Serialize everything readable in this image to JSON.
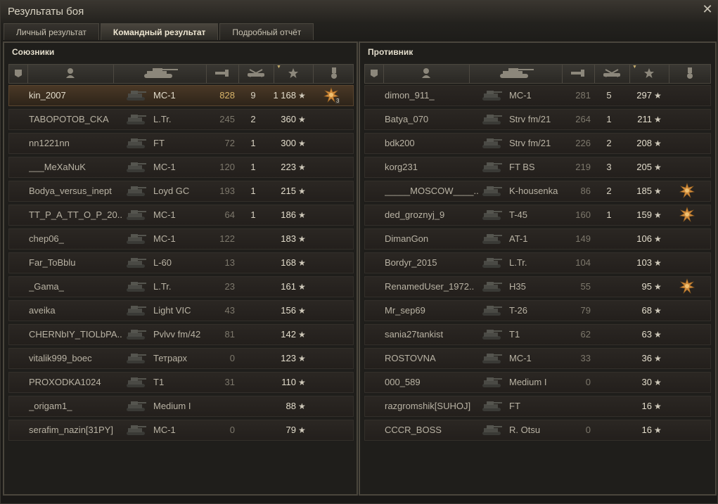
{
  "window": {
    "title": "Результаты боя"
  },
  "tabs": [
    {
      "label": "Личный результат",
      "active": false
    },
    {
      "label": "Командный результат",
      "active": true
    },
    {
      "label": "Подробный отчёт",
      "active": false
    }
  ],
  "header_icons": [
    "rank-icon",
    "player-icon",
    "tank-icon",
    "damage-icon",
    "kills-icon",
    "experience-star-icon",
    "medal-icon"
  ],
  "allies": {
    "title": "Союзники",
    "rows": [
      {
        "name": "kin_2007",
        "tank": "MC-1",
        "damage": "828",
        "kills": "9",
        "xp": "1 168",
        "medal": "3",
        "player": true
      },
      {
        "name": "TABOPOTOB_CKA",
        "tank": "L.Tr.",
        "damage": "245",
        "kills": "2",
        "xp": "360"
      },
      {
        "name": "nn1221nn",
        "tank": "FT",
        "damage": "72",
        "kills": "1",
        "xp": "300"
      },
      {
        "name": "___MeXaNuK",
        "tank": "MC-1",
        "damage": "120",
        "kills": "1",
        "xp": "223"
      },
      {
        "name": "Bodya_versus_inept",
        "tank": "Loyd GC",
        "damage": "193",
        "kills": "1",
        "xp": "215"
      },
      {
        "name": "TT_P_A_TT_O_P_20..",
        "tank": "MC-1",
        "damage": "64",
        "kills": "1",
        "xp": "186"
      },
      {
        "name": "chep06_",
        "tank": "MC-1",
        "damage": "122",
        "kills": "",
        "xp": "183"
      },
      {
        "name": "Far_ToBblu",
        "tank": "L-60",
        "damage": "13",
        "kills": "",
        "xp": "168"
      },
      {
        "name": "_Gama_",
        "tank": "L.Tr.",
        "damage": "23",
        "kills": "",
        "xp": "161"
      },
      {
        "name": "aveika",
        "tank": "Light VIC",
        "damage": "43",
        "kills": "",
        "xp": "156"
      },
      {
        "name": "CHERNbIY_TIOLbPA..",
        "tank": "Pvlvv fm/42",
        "damage": "81",
        "kills": "",
        "xp": "142"
      },
      {
        "name": "vitalik999_boec",
        "tank": "Тетрарх",
        "damage": "0",
        "kills": "",
        "xp": "123"
      },
      {
        "name": "PROXODKA1024",
        "tank": "T1",
        "damage": "31",
        "kills": "",
        "xp": "110"
      },
      {
        "name": "_origam1_",
        "tank": "Medium I",
        "damage": "",
        "kills": "",
        "xp": "88"
      },
      {
        "name": "serafim_nazin[31PY]",
        "tank": "MC-1",
        "damage": "0",
        "kills": "",
        "xp": "79"
      }
    ]
  },
  "enemies": {
    "title": "Противник",
    "rows": [
      {
        "name": "dimon_911_",
        "tank": "MC-1",
        "damage": "281",
        "kills": "5",
        "xp": "297"
      },
      {
        "name": "Batya_070",
        "tank": "Strv fm/21",
        "damage": "264",
        "kills": "1",
        "xp": "211"
      },
      {
        "name": "bdk200",
        "tank": "Strv fm/21",
        "damage": "226",
        "kills": "2",
        "xp": "208"
      },
      {
        "name": "korg231",
        "tank": "FT BS",
        "damage": "219",
        "kills": "3",
        "xp": "205"
      },
      {
        "name": "_____MOSCOW____..",
        "tank": "K-housenka",
        "damage": "86",
        "kills": "2",
        "xp": "185",
        "medal": ""
      },
      {
        "name": "ded_groznyj_9",
        "tank": "T-45",
        "damage": "160",
        "kills": "1",
        "xp": "159",
        "medal": ""
      },
      {
        "name": "DimanGon",
        "tank": "AT-1",
        "damage": "149",
        "kills": "",
        "xp": "106"
      },
      {
        "name": "Bordyr_2015",
        "tank": "L.Tr.",
        "damage": "104",
        "kills": "",
        "xp": "103"
      },
      {
        "name": "RenamedUser_1972..",
        "tank": "H35",
        "damage": "55",
        "kills": "",
        "xp": "95",
        "medal": ""
      },
      {
        "name": "Mr_sep69",
        "tank": "T-26",
        "damage": "79",
        "kills": "",
        "xp": "68"
      },
      {
        "name": "sania27tankist",
        "tank": "T1",
        "damage": "62",
        "kills": "",
        "xp": "63"
      },
      {
        "name": "ROSTOVNA",
        "tank": "MC-1",
        "damage": "33",
        "kills": "",
        "xp": "36"
      },
      {
        "name": "000_589",
        "tank": "Medium I",
        "damage": "0",
        "kills": "",
        "xp": "30"
      },
      {
        "name": "razgromshik[SUHOJ]",
        "tank": "FT",
        "damage": "",
        "kills": "",
        "xp": "16"
      },
      {
        "name": "CCCR_BOSS",
        "tank": "R. Otsu",
        "damage": "0",
        "kills": "",
        "xp": "16"
      }
    ]
  },
  "colors": {
    "panel_border": "#4a463d",
    "player_row": "#4a3826",
    "medal": "#d08a3a"
  }
}
